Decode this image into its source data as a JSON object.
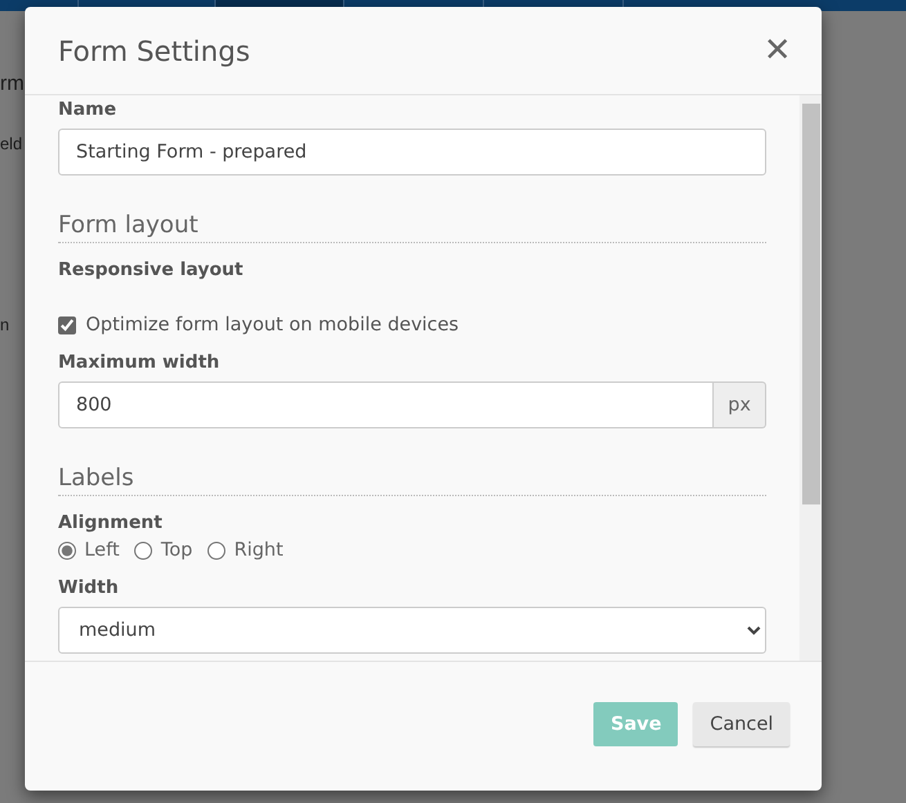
{
  "nav": {
    "items": [
      {
        "selected": false
      },
      {
        "selected": false
      },
      {
        "selected": true
      },
      {
        "selected": false
      },
      {
        "selected": false
      }
    ]
  },
  "background": {
    "heading": "rm",
    "subheading": "eld",
    "side_text": "n"
  },
  "dialog": {
    "title": "Form Settings",
    "close": "✕",
    "name_label": "Name",
    "name_value": "Starting Form - prepared",
    "sections": [
      {
        "title": "Form layout",
        "fields": [
          {
            "kind": "heading",
            "label": "Responsive layout"
          },
          {
            "kind": "checkbox",
            "label": "Optimize form layout on mobile devices",
            "checked": true
          },
          {
            "kind": "addon",
            "label": "Maximum width",
            "value": "800",
            "addon": "px"
          }
        ]
      },
      {
        "title": "Labels",
        "fields": [
          {
            "kind": "radios",
            "label": "Alignment",
            "options": [
              {
                "label": "Left",
                "selected": true
              },
              {
                "label": "Top",
                "selected": false
              },
              {
                "label": "Right",
                "selected": false
              }
            ]
          },
          {
            "kind": "select",
            "label": "Width",
            "value": "medium"
          }
        ]
      }
    ],
    "buttons": [
      {
        "label": "Save",
        "kind": "primary"
      },
      {
        "label": "Cancel",
        "kind": "default"
      }
    ]
  }
}
